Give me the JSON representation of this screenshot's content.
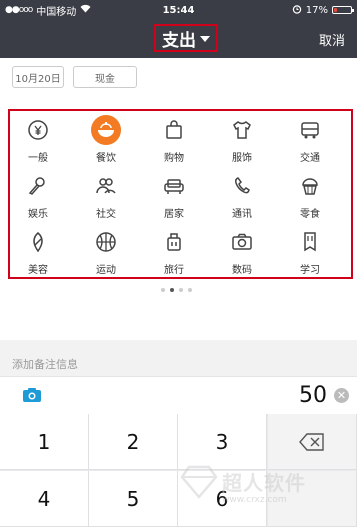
{
  "status_bar": {
    "signal": "●●ooo",
    "carrier": "中国移动",
    "time": "15:44",
    "battery": "17%",
    "battery_level": 0.17
  },
  "nav": {
    "title": "支出",
    "cancel": "取消"
  },
  "filters": {
    "date": "10月20日",
    "account": "现金"
  },
  "categories": [
    {
      "label": "一般",
      "icon": "coin-icon"
    },
    {
      "label": "餐饮",
      "icon": "bowl-icon",
      "selected": true
    },
    {
      "label": "购物",
      "icon": "shopping-bag-icon"
    },
    {
      "label": "服饰",
      "icon": "shirt-icon"
    },
    {
      "label": "交通",
      "icon": "bus-icon"
    },
    {
      "label": "娱乐",
      "icon": "microphone-icon"
    },
    {
      "label": "社交",
      "icon": "people-icon"
    },
    {
      "label": "居家",
      "icon": "sofa-icon"
    },
    {
      "label": "通讯",
      "icon": "phone-icon"
    },
    {
      "label": "零食",
      "icon": "cupcake-icon"
    },
    {
      "label": "美容",
      "icon": "leaf-icon"
    },
    {
      "label": "运动",
      "icon": "basketball-icon"
    },
    {
      "label": "旅行",
      "icon": "luggage-icon"
    },
    {
      "label": "数码",
      "icon": "camera-icon"
    },
    {
      "label": "学习",
      "icon": "bookmark-icon"
    }
  ],
  "pager": {
    "pages": 4,
    "current": 1
  },
  "note_placeholder": "添加备注信息",
  "amount": "50",
  "keypad": [
    "1",
    "2",
    "3",
    "4",
    "5",
    "6"
  ],
  "watermark": {
    "text": "超人软件",
    "url": "www.crxz.com"
  },
  "colors": {
    "accent": "#f27b24",
    "highlight_box": "#d0021b",
    "header": "#3a3d45",
    "camera": "#1e9bd7"
  }
}
